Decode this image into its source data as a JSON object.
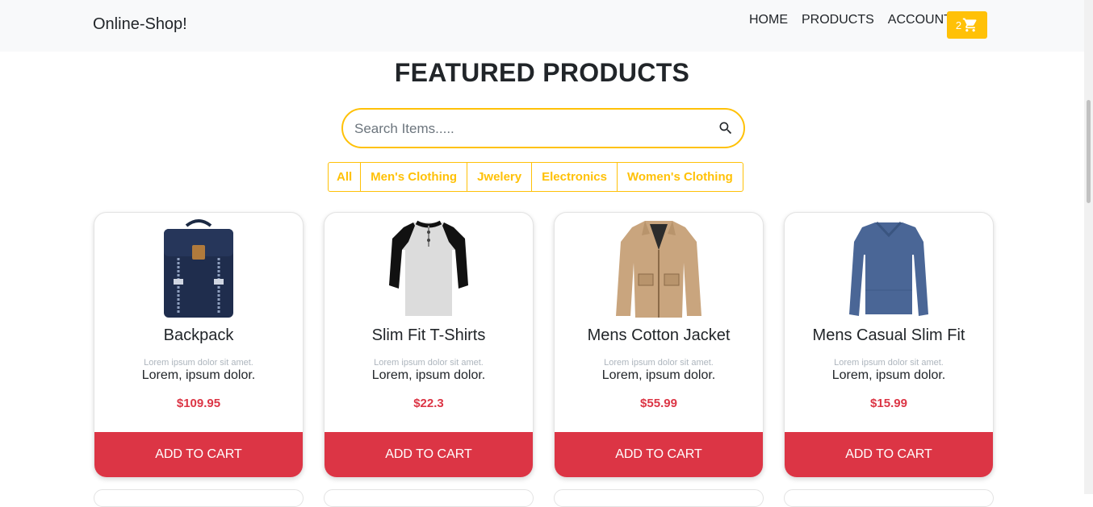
{
  "navbar": {
    "brand": "Online-Shop!",
    "links": [
      "HOME",
      "PRODUCTS",
      "ACCOUNT"
    ],
    "cart_count": "2",
    "cart_icon": "cart-icon",
    "accent": "#ffc107"
  },
  "main": {
    "title": "FEATURED PRODUCTS",
    "search": {
      "placeholder": "Search Items.....",
      "value": "",
      "icon": "search-icon"
    },
    "filters": [
      "All",
      "Men's Clothing",
      "Jwelery",
      "Electronics",
      "Women's Clothing"
    ]
  },
  "products": [
    {
      "title": "Backpack",
      "small_text": "Lorem ipsum dolor sit amet.",
      "text": "Lorem, ipsum dolor.",
      "price": "$109.95",
      "button": "ADD TO CART",
      "image": "backpack-image"
    },
    {
      "title": "Slim Fit T-Shirts",
      "small_text": "Lorem ipsum dolor sit amet.",
      "text": "Lorem, ipsum dolor.",
      "price": "$22.3",
      "button": "ADD TO CART",
      "image": "raglan-tshirt-image"
    },
    {
      "title": "Mens Cotton Jacket",
      "small_text": "Lorem ipsum dolor sit amet.",
      "text": "Lorem, ipsum dolor.",
      "price": "$55.99",
      "button": "ADD TO CART",
      "image": "cotton-jacket-image"
    },
    {
      "title": "Mens Casual Slim Fit",
      "small_text": "Lorem ipsum dolor sit amet.",
      "text": "Lorem, ipsum dolor.",
      "price": "$15.99",
      "button": "ADD TO CART",
      "image": "blue-longsleeve-image"
    }
  ],
  "colors": {
    "price": "#dc3545",
    "button": "#dc3545",
    "accent": "#ffc107"
  }
}
